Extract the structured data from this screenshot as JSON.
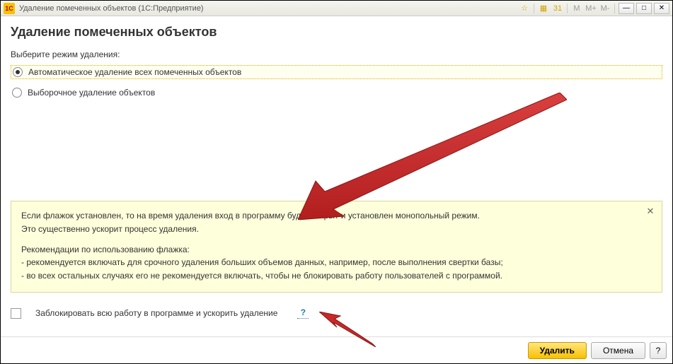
{
  "window": {
    "title": "Удаление помеченных объектов  (1С:Предприятие)",
    "appIconText": "1C"
  },
  "toolbarGlyphs": {
    "star": "☆",
    "grid": "▦",
    "calendar": "31",
    "m": "M",
    "mplus": "M+",
    "mminus": "M-",
    "minimize": "—",
    "maximize": "□",
    "close": "✕"
  },
  "page": {
    "title": "Удаление помеченных объектов",
    "modeLabel": "Выберите режим удаления:"
  },
  "radios": {
    "option1": "Автоматическое удаление всех помеченных объектов",
    "option2": "Выборочное удаление объектов"
  },
  "hint": {
    "line1": "Если флажок установлен, то на время удаления вход в программу будет закрыт и установлен монопольный режим.",
    "line2": "Это существенно ускорит процесс удаления.",
    "rec_title": "Рекомендации по использованию флажка:",
    "rec1": "- рекомендуется включать для срочного удаления больших объемов данных, например, после выполнения свертки базы;",
    "rec2": "- во всех остальных случаях его не рекомендуется включать, чтобы не блокировать работу пользователей с программой.",
    "close": "✕"
  },
  "checkbox": {
    "label": "Заблокировать всю работу в программе и ускорить удаление",
    "help": "?"
  },
  "buttons": {
    "delete": "Удалить",
    "cancel": "Отмена",
    "help": "?"
  }
}
